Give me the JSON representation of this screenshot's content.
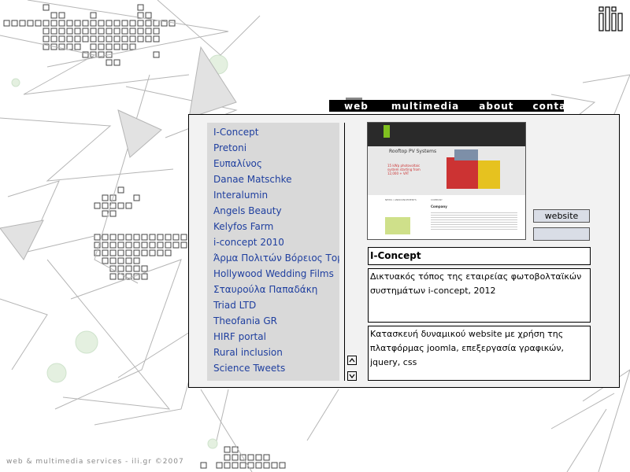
{
  "nav": {
    "items": [
      {
        "label": "web"
      },
      {
        "label": "multimedia"
      },
      {
        "label": "about"
      },
      {
        "label": "contact"
      }
    ]
  },
  "projects": [
    "I-Concept",
    "Pretoni",
    "Ευπαλίνος",
    "Danae Matschke",
    "Interalumin",
    "Angels Beauty",
    "Kelyfos Farm",
    "i-concept 2010",
    "Άρμα Πολιτών Βόρειος Τομέας",
    "Hollywood Wedding Films",
    "Σταυρούλα Παπαδάκη",
    "Triad LTD",
    "Theofania GR",
    "HIRF portal",
    "Rural inclusion",
    "Science Tweets"
  ],
  "detail": {
    "website_label": "website",
    "title": "I-Concept",
    "description": "Δικτυακός τόπος της εταιρείας φωτοβολταϊκών συστημάτων i-concept, 2012",
    "tech": "Κατασκευή δυναμικού website με χρήση της πλατφόρμας joomla, επεξεργασία γραφικών, jquery, css"
  },
  "preview": {
    "heading": "Rooftop PV Systems",
    "tagline": "15 kWp photovoltaic system starting from 12,000 + VAT",
    "section_news": "NEWS / ANNOUNCEMENTS",
    "section_company": "COMPANY",
    "company_title": "Company"
  },
  "footer": {
    "text": "web & multimedia services - ili.gr ©2007"
  },
  "colors": {
    "link": "#1f3f9f",
    "panel_bg": "#f2f2f2",
    "list_bg": "#d9d9d9",
    "nav_bg": "#000000",
    "button_bg": "#d9dde6",
    "accent_green": "#7fbf1f",
    "footer_text": "#8a8a8a"
  }
}
